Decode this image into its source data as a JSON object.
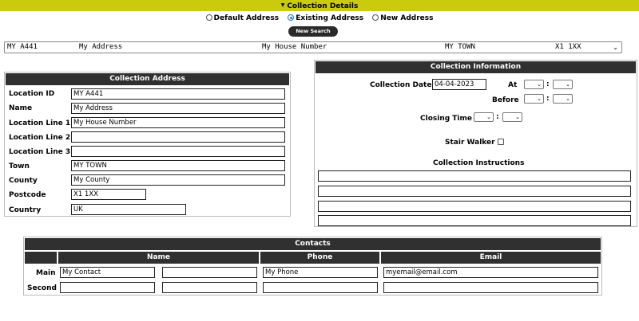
{
  "header": {
    "title": "Collection Details"
  },
  "address_mode": {
    "options": [
      {
        "label": "Default Address",
        "selected": false
      },
      {
        "label": "Existing Address",
        "selected": true
      },
      {
        "label": "New Address",
        "selected": false
      }
    ],
    "new_search_label": "New Search"
  },
  "address_select": {
    "col1": "MY A441",
    "col2": "My Address",
    "col3": "My House Number",
    "col4": "MY TOWN",
    "col5": "X1 1XX"
  },
  "collection_address": {
    "title": "Collection Address",
    "fields": [
      {
        "label": "Location ID",
        "value": "MY A441"
      },
      {
        "label": "Name",
        "value": "My Address"
      },
      {
        "label": "Location Line 1",
        "value": "My House Number"
      },
      {
        "label": "Location Line 2",
        "value": ""
      },
      {
        "label": "Location Line 3",
        "value": ""
      },
      {
        "label": "Town",
        "value": "MY TOWN"
      },
      {
        "label": "County",
        "value": "My County"
      },
      {
        "label": "Postcode",
        "value": "X1 1XX"
      },
      {
        "label": "Country",
        "value": "UK"
      }
    ]
  },
  "collection_info": {
    "title": "Collection Information",
    "date_label": "Collection Date",
    "date_value": "04-04-2023",
    "at_label": "At",
    "before_label": "Before",
    "closing_label": "Closing Time",
    "stair_label": "Stair Walker",
    "stair_checked": false,
    "instructions_label": "Collection Instructions",
    "colon": ":"
  },
  "contacts": {
    "title": "Contacts",
    "columns": [
      "Name",
      "Phone",
      "Email"
    ],
    "rows": [
      {
        "label": "Main",
        "name1": "My Contact",
        "name2": "",
        "phone": "My Phone",
        "email": "myemail@email.com"
      },
      {
        "label": "Second",
        "name1": "",
        "name2": "",
        "phone": "",
        "email": ""
      }
    ]
  },
  "colors": {
    "topbar": "#c9cb0c",
    "header": "#303030",
    "radio_on": "#1a73c8"
  },
  "icons": {
    "caret": "caret-down-icon",
    "select": "chevron-down-icon"
  }
}
